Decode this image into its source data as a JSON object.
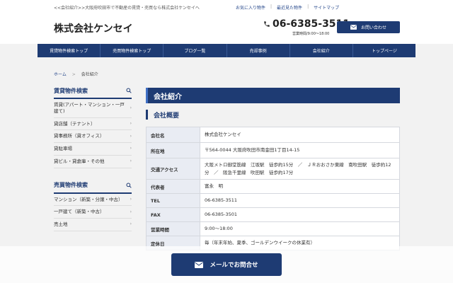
{
  "header": {
    "tagline": "<<会社紹介>>大阪府吹田市で不動産の賃貸・売買なら株式会社ケンセイへ",
    "top_links": [
      "お気に入り物件",
      "最近見た物件",
      "サイトマップ"
    ],
    "logo": "株式会社ケンセイ",
    "phone": "06-6385-3511",
    "hours": "営業時間/9:00～18:00",
    "contact_label": "お問い合わせ"
  },
  "nav": {
    "items": [
      "賃貸物件検索トップ",
      "売買物件検索トップ",
      "ブログ一覧",
      "売却事例",
      "会社紹介",
      "トップページ"
    ]
  },
  "breadcrumb": {
    "home": "ホーム",
    "current": "会社紹介"
  },
  "sidebar": {
    "rental_title": "賃貸物件検索",
    "rental_items": [
      "賃貸(アパート・マンション・一戸建て)",
      "貸店舗（テナント）",
      "貸事務所（貸オフィス）",
      "貸駐車場",
      "貸ビル・貸倉庫・その他"
    ],
    "sale_title": "売買物件検索",
    "sale_items": [
      "マンション（新築・分譲・中古）",
      "一戸建て（新築・中古）",
      "売土地"
    ]
  },
  "main": {
    "page_title": "会社紹介",
    "section_title": "会社概要",
    "rows": [
      {
        "label": "会社名",
        "value": "株式会社ケンセイ"
      },
      {
        "label": "所在地",
        "value": "〒564-0044 大阪府吹田市南金田1丁目14-15"
      },
      {
        "label": "交通アクセス",
        "value": "大阪メトロ御堂筋線　江坂駅　徒歩約15分　／　ＪＲおおさか東線　南吹田駅　徒歩約12分　／　阪急千里線　吹田駅　徒歩約17分"
      },
      {
        "label": "代表者",
        "value": "富永　明"
      },
      {
        "label": "TEL",
        "value": "06-6385-3511"
      },
      {
        "label": "FAX",
        "value": "06-6385-3501"
      },
      {
        "label": "営業時間",
        "value": "9:00～18:00"
      },
      {
        "label": "定休日",
        "value": "毎（年末年始、夏季、ゴールデンウイークの休業有）"
      }
    ]
  },
  "floating": {
    "mail_label": "メールでお問合せ"
  },
  "icons": {
    "phone": "phone-icon",
    "mail": "mail-icon",
    "search": "search-icon",
    "chevron": "chevron-right-icon"
  },
  "colors": {
    "primary": "#1e3b73",
    "accent": "#3f6fc4",
    "table_header_bg": "#e9ecf3"
  }
}
